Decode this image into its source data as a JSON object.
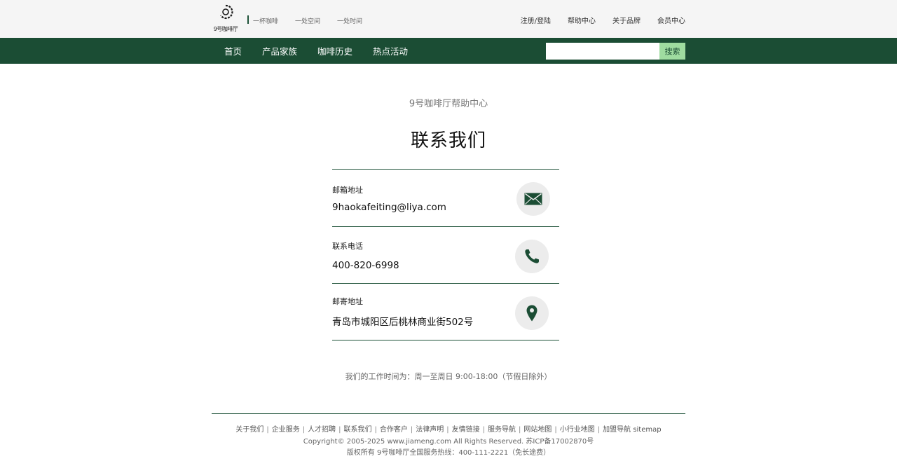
{
  "header": {
    "logo_text": "9号咖啡厅",
    "slogans": [
      "一杯咖啡",
      "一处空间",
      "一处时间"
    ],
    "top_nav": [
      "注册/登陆",
      "帮助中心",
      "关于品牌",
      "会员中心"
    ]
  },
  "nav": {
    "items": [
      "首页",
      "产品家族",
      "咖啡历史",
      "热点活动"
    ],
    "search_value": "",
    "search_button": "搜索"
  },
  "main": {
    "subtitle": "9号咖啡厅帮助中心",
    "title": "联系我们",
    "contacts": [
      {
        "label": "邮箱地址",
        "value": "9haokafeiting@liya.com",
        "icon": "mail-icon"
      },
      {
        "label": "联系电话",
        "value": "400-820-6998",
        "icon": "phone-icon"
      },
      {
        "label": "邮寄地址",
        "value": "青岛市城阳区后桃林商业街502号",
        "icon": "map-pin-icon"
      }
    ],
    "hours": "我们的工作时间为：周一至周日 9:00-18:00（节假日除外）"
  },
  "footer": {
    "links": [
      "关于我们",
      "企业服务",
      "人才招聘",
      "联系我们",
      "合作客户",
      "法律声明",
      "友情链接",
      "服务导航",
      "网站地图",
      "小行业地图",
      "加盟导航 sitemap"
    ],
    "copyright": "Copyright© 2005-2025 www.jiameng.com All Rights Reserved.  苏ICP备17002870号",
    "rights": "版权所有 9号咖啡厅全国服务热线：400-111-2221（免长途费）"
  },
  "colors": {
    "brand_green": "#1b4d34",
    "search_button_bg": "#9fdca0",
    "icon_bg": "#ececec"
  }
}
